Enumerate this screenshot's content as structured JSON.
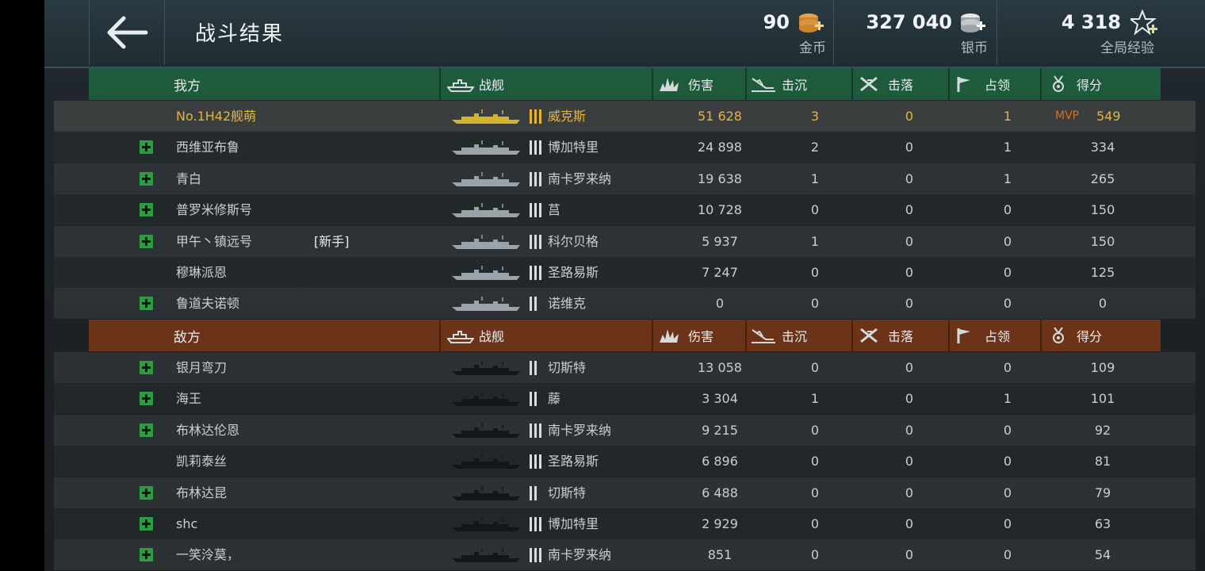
{
  "header": {
    "title": "战斗结果",
    "gold": {
      "value": "90",
      "label": "金币"
    },
    "silver": {
      "value": "327 040",
      "label": "银币"
    },
    "xp": {
      "value": "4 318",
      "label": "全局经验"
    }
  },
  "columns": {
    "ship": "战舰",
    "damage": "伤害",
    "sunk": "击沉",
    "shot_down": "击落",
    "capture": "占领",
    "score": "得分"
  },
  "allies": {
    "title": "我方",
    "rows": [
      {
        "name": "No.1H42舰萌",
        "tag": "",
        "add": false,
        "mine": true,
        "tier": 3,
        "ship": "威克斯",
        "damage": "51 628",
        "sunk": "3",
        "shot_down": "0",
        "capture": "1",
        "mvp": "MVP",
        "score": "549"
      },
      {
        "name": "西维亚布鲁",
        "tag": "",
        "add": true,
        "mine": false,
        "tier": 3,
        "ship": "博加特里",
        "damage": "24 898",
        "sunk": "2",
        "shot_down": "0",
        "capture": "1",
        "mvp": "",
        "score": "334"
      },
      {
        "name": "青白",
        "tag": "",
        "add": true,
        "mine": false,
        "tier": 3,
        "ship": "南卡罗来纳",
        "damage": "19 638",
        "sunk": "1",
        "shot_down": "0",
        "capture": "1",
        "mvp": "",
        "score": "265"
      },
      {
        "name": "普罗米修斯号",
        "tag": "",
        "add": true,
        "mine": false,
        "tier": 3,
        "ship": "莒",
        "damage": "10 728",
        "sunk": "0",
        "shot_down": "0",
        "capture": "0",
        "mvp": "",
        "score": "150"
      },
      {
        "name": "甲午丶镇远号",
        "tag": "[新手]",
        "add": true,
        "mine": false,
        "tier": 3,
        "ship": "科尔贝格",
        "damage": "5 937",
        "sunk": "1",
        "shot_down": "0",
        "capture": "0",
        "mvp": "",
        "score": "150"
      },
      {
        "name": "穆琳派恩",
        "tag": "",
        "add": false,
        "mine": false,
        "tier": 3,
        "ship": "圣路易斯",
        "damage": "7 247",
        "sunk": "0",
        "shot_down": "0",
        "capture": "0",
        "mvp": "",
        "score": "125"
      },
      {
        "name": "鲁道夫诺顿",
        "tag": "",
        "add": true,
        "mine": false,
        "tier": 2,
        "ship": "诺维克",
        "damage": "0",
        "sunk": "0",
        "shot_down": "0",
        "capture": "0",
        "mvp": "",
        "score": "0"
      }
    ]
  },
  "enemies": {
    "title": "敌方",
    "rows": [
      {
        "name": "银月弯刀",
        "tag": "",
        "add": true,
        "mine": false,
        "tier": 2,
        "ship": "切斯特",
        "damage": "13 058",
        "sunk": "0",
        "shot_down": "0",
        "capture": "0",
        "mvp": "",
        "score": "109"
      },
      {
        "name": "海王",
        "tag": "",
        "add": true,
        "mine": false,
        "tier": 2,
        "ship": "藤",
        "damage": "3 304",
        "sunk": "1",
        "shot_down": "0",
        "capture": "1",
        "mvp": "",
        "score": "101"
      },
      {
        "name": "布林达伦恩",
        "tag": "",
        "add": true,
        "mine": false,
        "tier": 3,
        "ship": "南卡罗来纳",
        "damage": "9 215",
        "sunk": "0",
        "shot_down": "0",
        "capture": "0",
        "mvp": "",
        "score": "92"
      },
      {
        "name": "凯莉泰丝",
        "tag": "",
        "add": false,
        "mine": false,
        "tier": 3,
        "ship": "圣路易斯",
        "damage": "6 896",
        "sunk": "0",
        "shot_down": "0",
        "capture": "0",
        "mvp": "",
        "score": "81"
      },
      {
        "name": "布林达昆",
        "tag": "",
        "add": true,
        "mine": false,
        "tier": 2,
        "ship": "切斯特",
        "damage": "6 488",
        "sunk": "0",
        "shot_down": "0",
        "capture": "0",
        "mvp": "",
        "score": "79"
      },
      {
        "name": "shc",
        "tag": "",
        "add": true,
        "mine": false,
        "tier": 3,
        "ship": "博加特里",
        "damage": "2 929",
        "sunk": "0",
        "shot_down": "0",
        "capture": "0",
        "mvp": "",
        "score": "63"
      },
      {
        "name": "一笑泠莫，",
        "tag": "",
        "add": true,
        "mine": false,
        "tier": 3,
        "ship": "南卡罗来纳",
        "damage": "851",
        "sunk": "0",
        "shot_down": "0",
        "capture": "0",
        "mvp": "",
        "score": "54"
      }
    ]
  },
  "colors": {
    "ally_header": "#1e5a3c",
    "enemy_header": "#6b3418",
    "highlight_text": "#e7b43a",
    "mvp": "#d8701e",
    "add_button": "#2f9b45"
  },
  "icons": {
    "back": "arrow-left-icon",
    "gold": "gold-coins-plus-icon",
    "silver": "silver-coins-plus-icon",
    "xp": "star-plus-icon",
    "ship": "ship-icon",
    "damage": "explosion-icon",
    "sunk": "sinking-ship-icon",
    "shot_down": "crossed-plane-icon",
    "capture": "flag-icon",
    "score": "medal-icon"
  }
}
